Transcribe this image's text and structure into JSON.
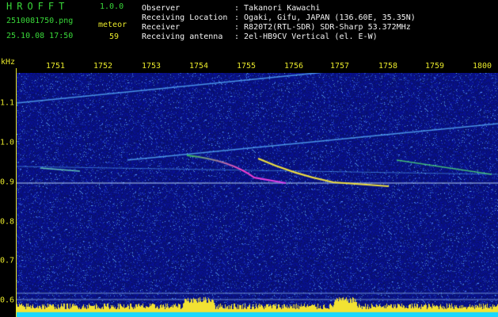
{
  "app": {
    "logo": "HROFFT",
    "version": "1.0.0",
    "filename": "2510081750.png",
    "datetime": "25.10.08 17:50",
    "count_label": "meteor",
    "count_value": "59"
  },
  "info": [
    {
      "label": "Observer",
      "value": ": Takanori Kawachi"
    },
    {
      "label": "Receiving Location",
      "value": ": Ogaki, Gifu, JAPAN (136.60E, 35.35N)"
    },
    {
      "label": "Receiver",
      "value": ": R820T2(RTL-SDR) SDR-Sharp 53.372MHz"
    },
    {
      "label": "Receiving antenna",
      "value": ": 2el-HB9CV Vertical (el. E-W)"
    }
  ],
  "axes": {
    "freq_unit": "kHz",
    "time_ticks": [
      "1751",
      "1752",
      "1753",
      "1754",
      "1755",
      "1756",
      "1757",
      "1758",
      "1759",
      "1800"
    ],
    "freq_ticks": [
      "1.1",
      "1.0",
      "0.9",
      "0.8",
      "0.7",
      "0.6"
    ]
  },
  "colors": {
    "background": "#000000",
    "noise": "#1a2a8f",
    "text_green": "#39d839",
    "text_yellow": "#e8e82a",
    "text_white": "#f4f4f4",
    "echo_hot": "#ff3fd0",
    "baseline_cyan": "#19d9ff",
    "baseline_yellow": "#f2e233"
  }
}
